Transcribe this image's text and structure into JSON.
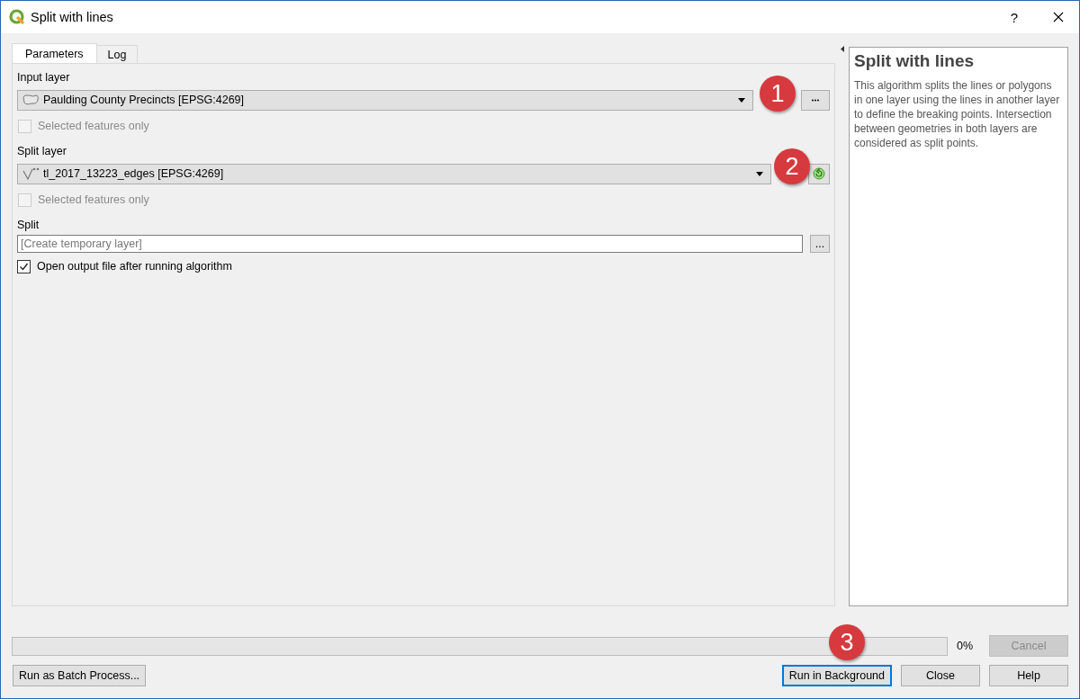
{
  "window": {
    "title": "Split with lines",
    "help_glyph": "?"
  },
  "tabs": [
    {
      "label": "Parameters",
      "selected": true
    },
    {
      "label": "Log",
      "selected": false
    }
  ],
  "parameters": [
    {
      "kind": "polygon-layer",
      "label": "Input layer",
      "value": "Paulding County Precincts [EPSG:4269]",
      "iterate": false,
      "selected_only": {
        "label": "Selected features only",
        "checked": false,
        "disabled": true
      }
    },
    {
      "kind": "line-layer",
      "label": "Split layer",
      "value": "tl_2017_13223_edges [EPSG:4269]",
      "iterate": true,
      "selected_only": {
        "label": "Selected features only",
        "checked": false,
        "disabled": true
      }
    },
    {
      "kind": "output",
      "label": "Split",
      "placeholder": "[Create temporary layer]",
      "button": "..."
    },
    {
      "kind": "checkbox",
      "label": "Open output file after running algorithm",
      "checked": true,
      "disabled": false
    }
  ],
  "help": {
    "title": "Split with lines",
    "text": "This algorithm splits the lines or polygons in one layer using the lines in another layer to define the breaking points. Intersection between geometries in both layers are considered as split points."
  },
  "progress": {
    "level": 0,
    "reading": "0%"
  },
  "cancel": {
    "label": "Cancel",
    "disabled": true
  },
  "batch_button": {
    "label": "Run as Batch Process..."
  },
  "buttons": [
    {
      "label": "Run in Background",
      "default": true
    },
    {
      "label": "Close",
      "default": false
    },
    {
      "label": "Help",
      "default": false
    }
  ],
  "callouts": [
    "1",
    "2",
    "3"
  ]
}
